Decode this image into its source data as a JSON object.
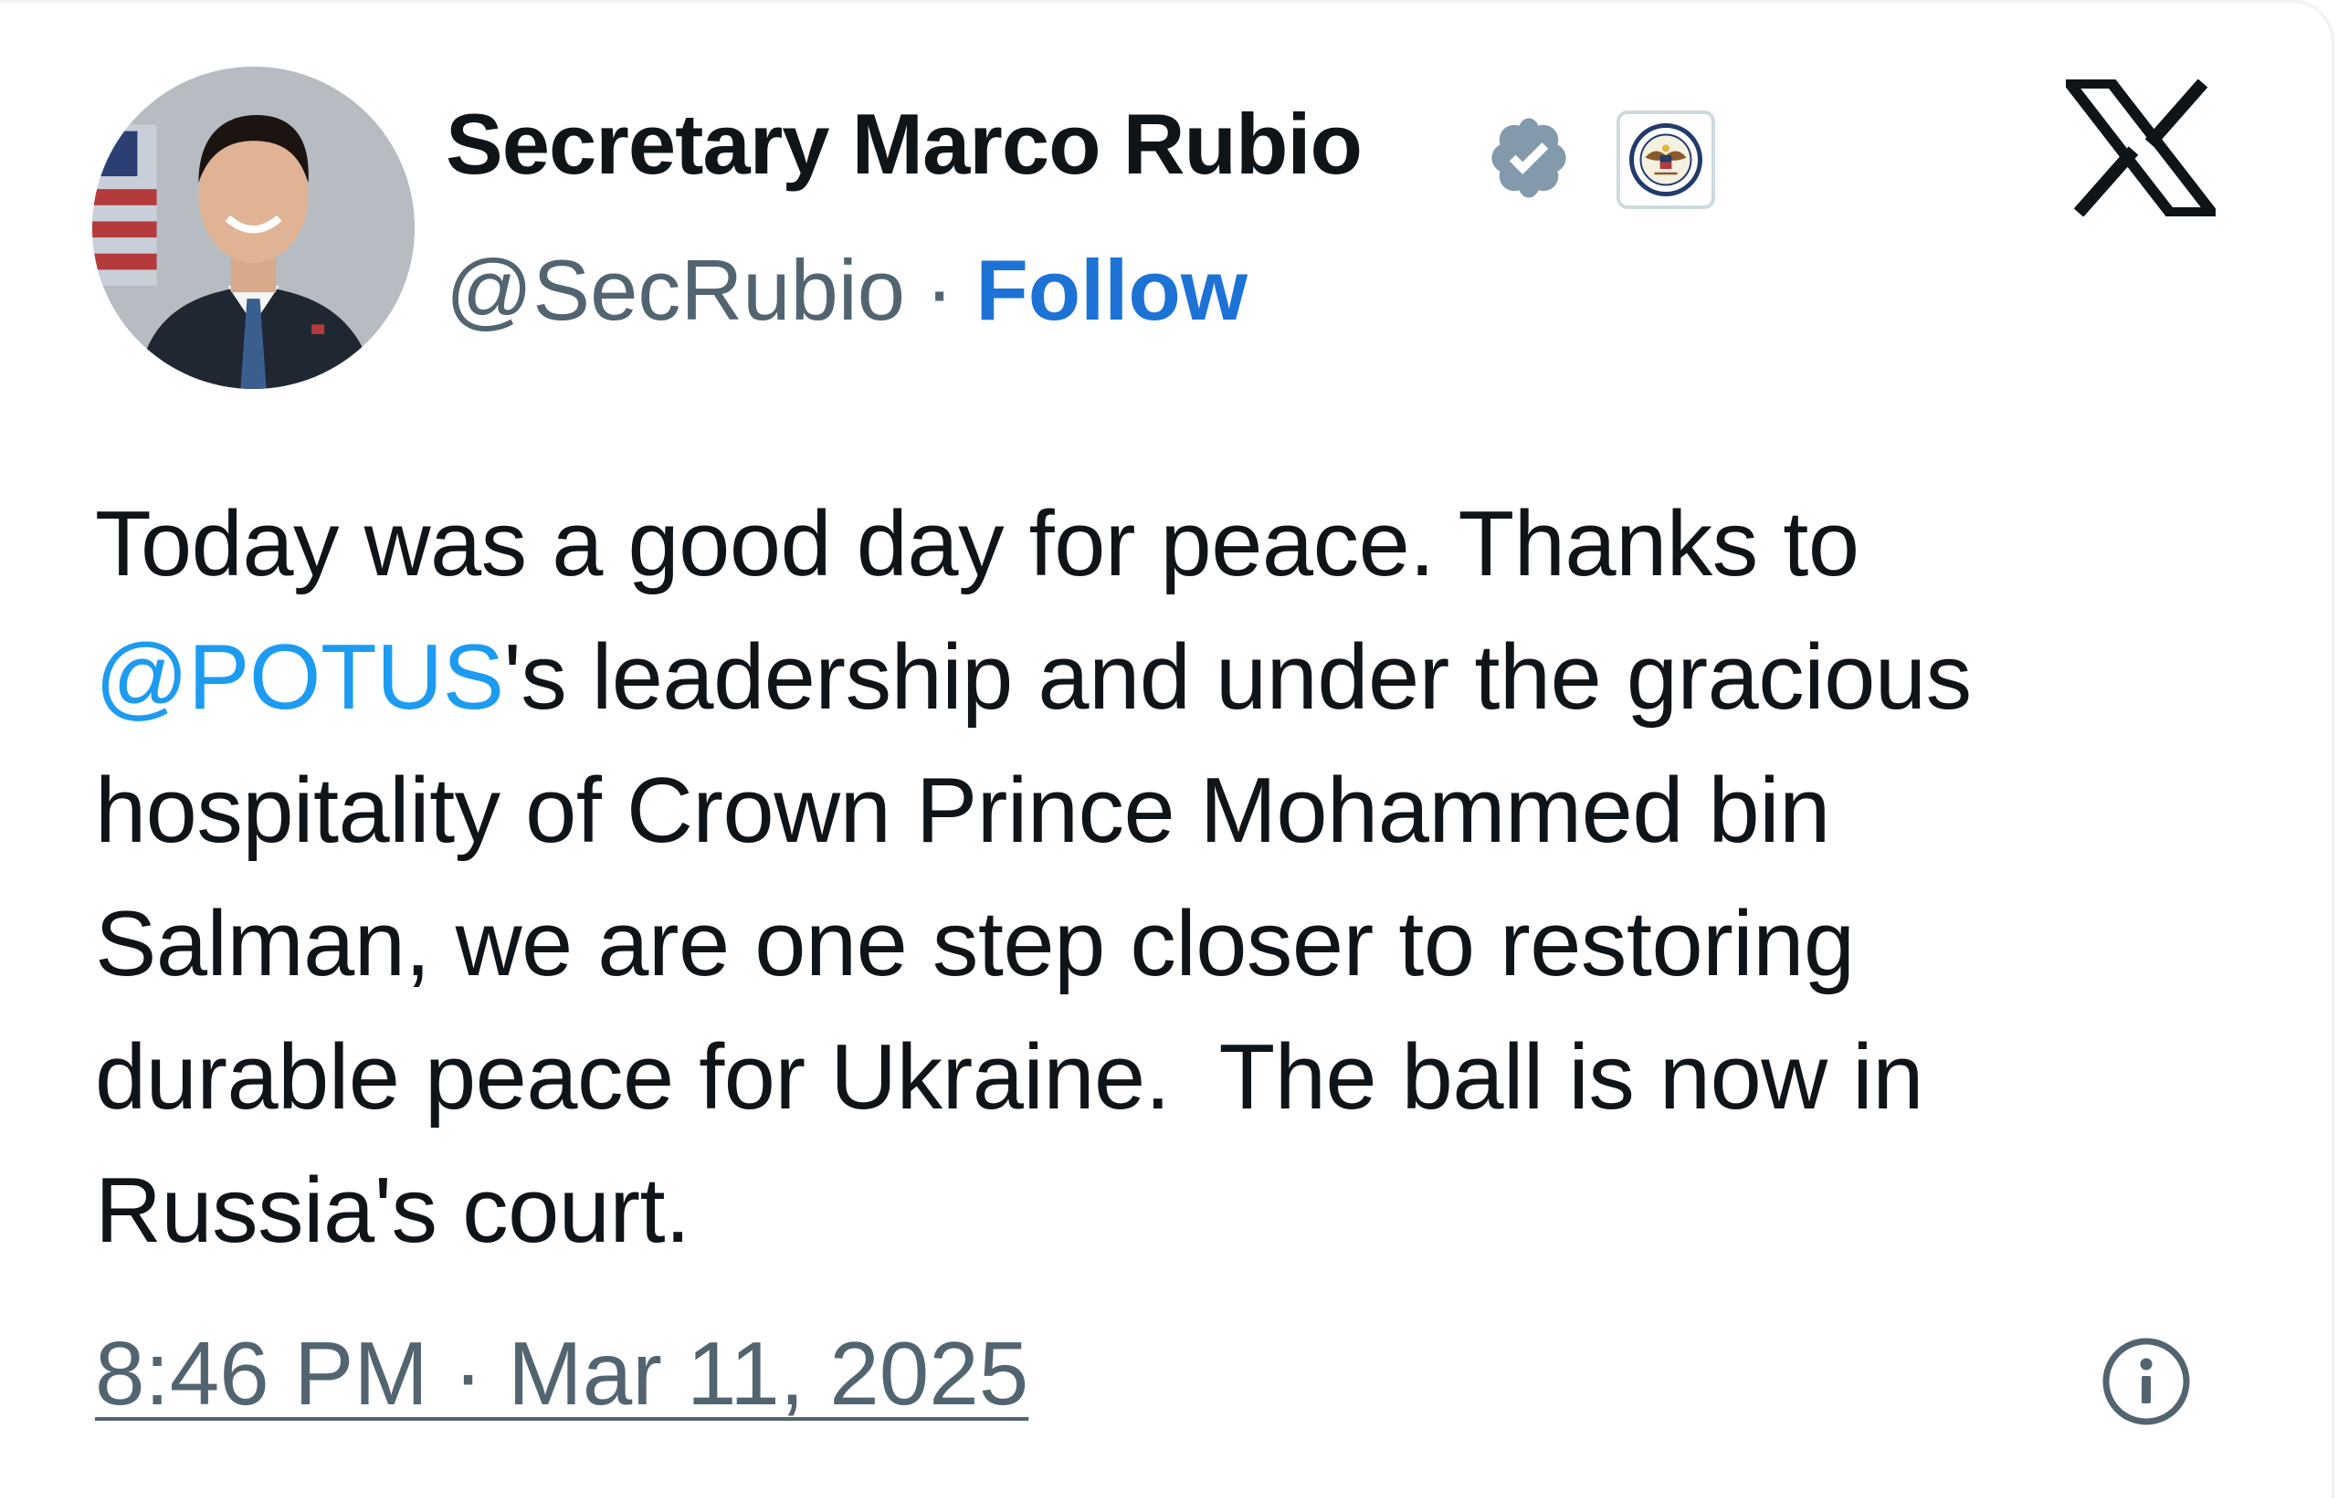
{
  "author": {
    "display_name": "Secretary Marco Rubio",
    "handle": "@SecRubio",
    "separator": "·",
    "follow_label": "Follow",
    "avatar_icon": "profile-photo",
    "verified_icon": "verified-badge-icon",
    "affiliate_icon": "state-department-seal-icon"
  },
  "brand": {
    "logo_icon": "x-logo-icon"
  },
  "tweet": {
    "lines": [
      {
        "before": "Today was a good day for peace. Thanks to",
        "mention": "",
        "after": ""
      },
      {
        "before": "",
        "mention": "@POTUS",
        "after": "'s leadership and under the gracious"
      },
      {
        "before": "hospitality of Crown Prince Mohammed bin",
        "mention": "",
        "after": ""
      },
      {
        "before": "Salman, we are one step closer to restoring",
        "mention": "",
        "after": ""
      },
      {
        "before": "durable peace for Ukraine.  The ball is now in",
        "mention": "",
        "after": ""
      },
      {
        "before": "Russia's court.",
        "mention": "",
        "after": ""
      }
    ]
  },
  "footer": {
    "timestamp": "8:46 PM · Mar 11, 2025",
    "info_icon": "info-icon"
  },
  "colors": {
    "text": "#0f1419",
    "secondary_text": "#536471",
    "mention": "#1d9bf0",
    "follow": "#1d72d6",
    "verified_badge": "#829aab"
  }
}
